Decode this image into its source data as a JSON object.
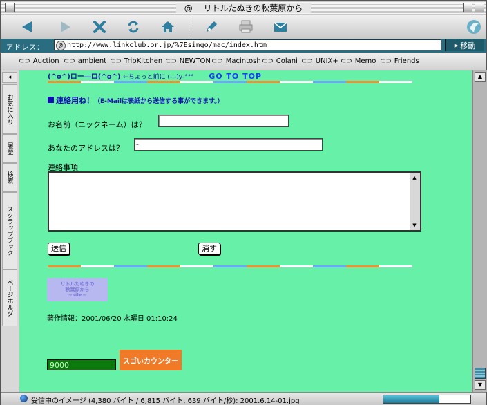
{
  "window": {
    "title": "リトルたぬきの秋葉原から",
    "title_icon": "@"
  },
  "toolbar": {
    "icons": [
      "back-arrow-icon",
      "forward-arrow-icon",
      "stop-x-icon",
      "refresh-icon",
      "home-icon",
      "edit-pen-icon",
      "print-icon",
      "mail-icon"
    ]
  },
  "address": {
    "label": "アドレス：",
    "url": "http://www.linkclub.or.jp/%7Esingo/mac/index.htm",
    "go_label": "移動"
  },
  "favorites": [
    "Auction",
    "ambient",
    "TripKitchen",
    "NEWTON",
    "Macintosh",
    "Colani",
    "UNIX+",
    "Memo",
    "Friends"
  ],
  "sidebar": {
    "tabs": [
      "お気に入り",
      "履歴",
      "検索",
      "スクラップブック",
      "ページホルダ"
    ]
  },
  "page": {
    "nav_face": "(^o^)ロー―ロ(^o^)",
    "nav_hint": "←ちょっと前に (-.-)y-°°°",
    "goto_top": "GO TO TOP",
    "heading": "連絡用ね！",
    "heading_note": "（E-Mailは表紙から送信する事ができます。）",
    "name_label": "お名前（ニックネーム）は？",
    "name_value": "",
    "address_label": "あなたのアドレスは？",
    "address_value": "-",
    "message_label": "連絡事項",
    "submit_label": "送信",
    "reset_label": "消す",
    "logo_text_1": "リトルたぬきの",
    "logo_text_2": "秋葉原から",
    "logo_text_3": "~site~",
    "update_label": "著作情報：2001/06/20 水曜日 01:10:24",
    "counter_value": "9000",
    "counter_logo": "スゴいカウンター"
  },
  "status": {
    "text": "受信中のイメージ (4,380 バイト / 6,815 バイト, 639 バイト/秒): 2001.6.14-01.jpg",
    "progress": 0.64
  }
}
